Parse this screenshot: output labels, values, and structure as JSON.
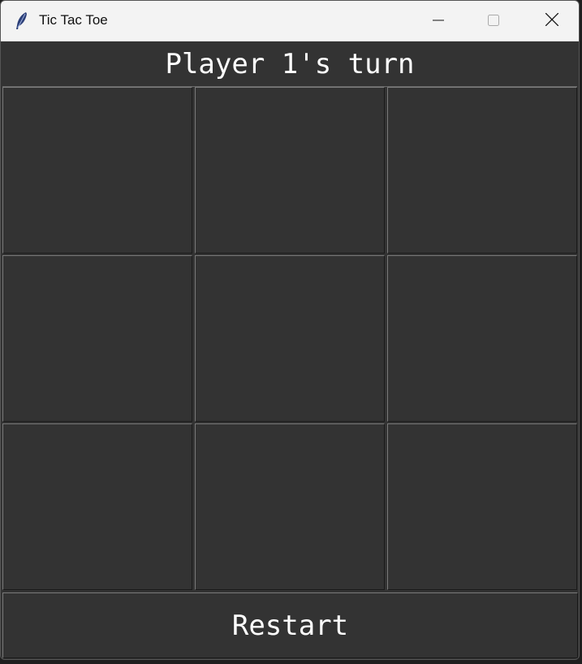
{
  "window": {
    "title": "Tic Tac Toe",
    "icon": "feather-icon",
    "controls": [
      "minimize-icon",
      "maximize-icon",
      "close-icon"
    ]
  },
  "status": {
    "text": "Player 1's turn"
  },
  "board": {
    "cells": [
      "",
      "",
      "",
      "",
      "",
      "",
      "",
      "",
      ""
    ]
  },
  "restart": {
    "label": "Restart"
  },
  "colors": {
    "background": "#333333",
    "text": "#ffffff",
    "titlebar": "#f3f3f3"
  }
}
